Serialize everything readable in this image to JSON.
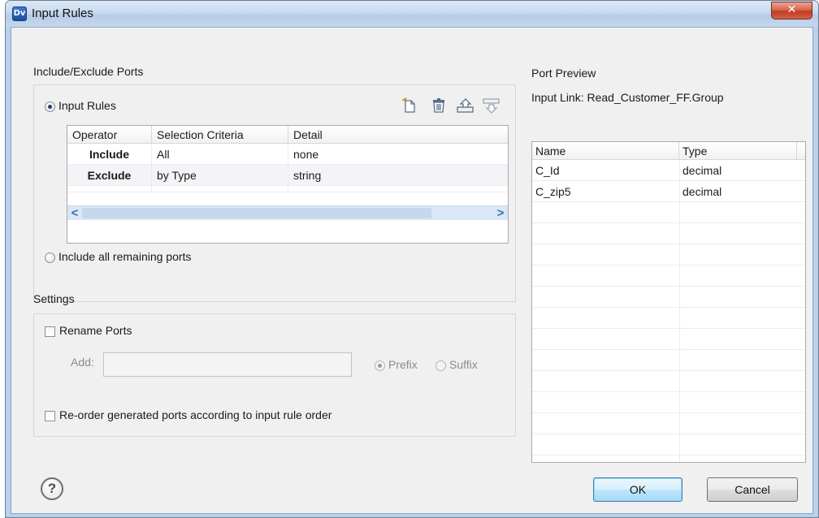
{
  "window": {
    "title": "Input Rules",
    "app_icon_text": "Dv",
    "close_glyph": "✕"
  },
  "include_exclude": {
    "section_label": "Include/Exclude Ports",
    "input_rules_label": "Input Rules",
    "include_remaining_label": "Include all remaining ports",
    "selected_mode": "Input Rules",
    "toolbar_icons": [
      "new-rule-icon",
      "delete-icon",
      "move-up-icon",
      "move-down-icon"
    ],
    "table": {
      "columns": [
        "Operator",
        "Selection Criteria",
        "Detail"
      ],
      "rows": [
        {
          "operator": "Include",
          "criteria": "All",
          "detail": "none"
        },
        {
          "operator": "Exclude",
          "criteria": "by Type",
          "detail": "string"
        }
      ],
      "scroll_left": "<",
      "scroll_right": ">"
    }
  },
  "settings": {
    "section_label": "Settings",
    "rename_ports_label": "Rename Ports",
    "rename_ports_checked": false,
    "add_label": "Add:",
    "add_value": "",
    "prefix_label": "Prefix",
    "suffix_label": "Suffix",
    "selected_affix": "Prefix",
    "reorder_label": "Re-order generated ports according to input rule order",
    "reorder_checked": false
  },
  "port_preview": {
    "section_label": "Port Preview",
    "input_link_label": "Input Link: Read_Customer_FF.Group",
    "columns": [
      "Name",
      "Type"
    ],
    "rows": [
      {
        "name": "C_Id",
        "type": "decimal"
      },
      {
        "name": "C_zip5",
        "type": "decimal"
      }
    ]
  },
  "footer": {
    "help_glyph": "?",
    "ok_label": "OK",
    "cancel_label": "Cancel"
  },
  "colors": {
    "title_bar": "#c8daee",
    "close_button": "#c23c1f",
    "dialog_bg": "#f0f0f0",
    "default_button": "#bee6fd",
    "radio_dot": "#1f3f7a"
  }
}
